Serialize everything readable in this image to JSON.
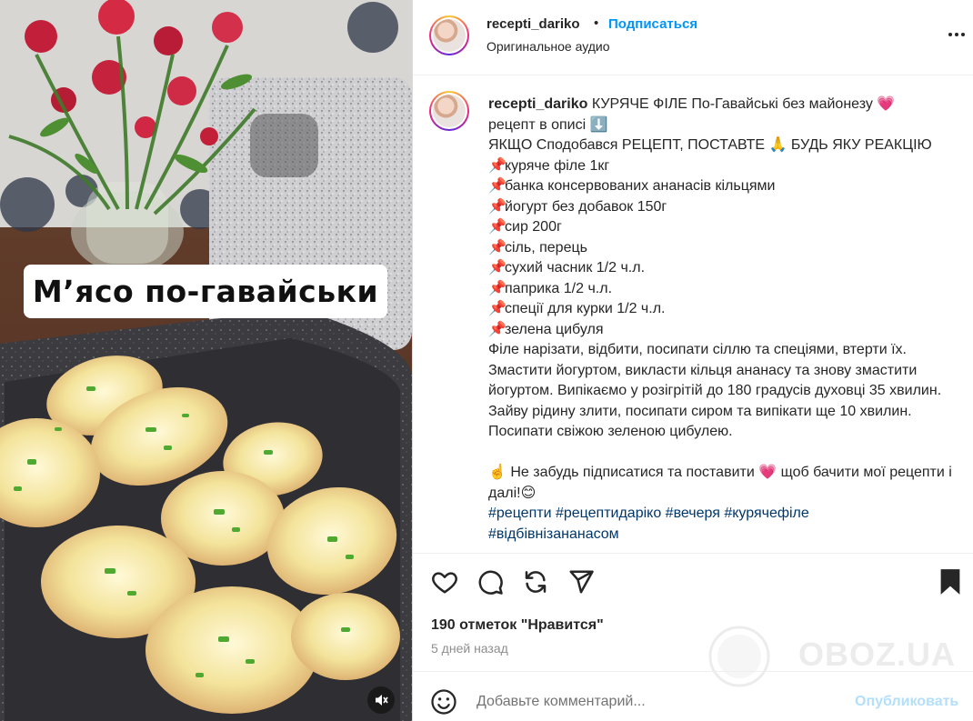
{
  "media": {
    "overlay_title": "М’ясо по-гавайськи"
  },
  "header": {
    "username": "recepti_dariko",
    "separator": "•",
    "follow_label": "Подписаться",
    "audio_label": "Оригинальное аудио"
  },
  "caption": {
    "username": "recepti_dariko",
    "title_line": "КУРЯЧЕ ФІЛЕ По-Гавайські без майонезу 💗",
    "line2": "рецепт в описі ⬇️",
    "line3": "ЯКЩО Сподобався РЕЦЕПТ, ПОСТАВТЕ 🙏 БУДЬ ЯКУ РЕАКЦІЮ",
    "ingredients": [
      "куряче філе 1кг",
      "банка консервованих ананасів кільцями",
      "йогурт без добавок 150г",
      "сир 200г",
      "сіль, перець",
      "сухий часник 1/2 ч.л.",
      "паприка 1/2 ч.л.",
      "спеції для курки 1/2 ч.л.",
      "зелена цибуля"
    ],
    "ingredient_icon": "📌",
    "instructions": "Філе нарізати, відбити, посипати сіллю та спеціями, втерти їх. Змастити йогуртом, викласти кільця ананасу та знову змастити йогуртом. Випікаємо у розігрітій до 180 градусів духовці 35 хвилин. Зайву рідину злити, посипати сиром та випікати ще 10 хвилин. Посипати свіжою зеленою цибулею.",
    "outro": "☝️ Не забудь підписатися та поставити 💗 щоб бачити мої рецепти і далі!😊",
    "hashtags_line1": "#рецепти #рецептидаріко #вечеря #курячефіле",
    "hashtags_line2": "#відбівнізананасом"
  },
  "stats": {
    "likes": "190 отметок \"Нравится\"",
    "date": "5 дней назад"
  },
  "comment": {
    "placeholder": "Добавьте комментарий...",
    "post_label": "Опубликовать"
  },
  "watermark": {
    "text": "OBOZ.UA"
  },
  "icons": [
    "heart-icon",
    "comment-icon",
    "share-icon",
    "send-icon",
    "bookmark-icon",
    "more-icon",
    "emoji-icon",
    "mute-icon"
  ],
  "colors": {
    "link_blue": "#0095f6",
    "hashtag_blue": "#00376b",
    "post_disabled": "#b2dffc",
    "text": "#262626",
    "muted": "#8e8e8e"
  }
}
